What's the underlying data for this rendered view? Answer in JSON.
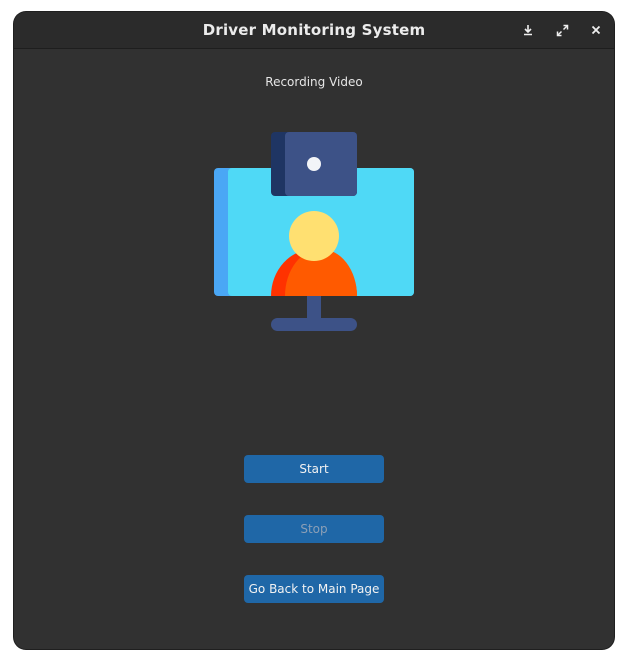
{
  "window": {
    "title": "Driver Monitoring System",
    "controls": [
      "download-icon",
      "expand-icon",
      "close-icon"
    ]
  },
  "main": {
    "heading": "Recording Video",
    "illustration": "webcam-monitor-person",
    "buttons": {
      "start_label": "Start",
      "stop_label": "Stop",
      "back_label": "Go Back to Main Page"
    }
  },
  "colors": {
    "window_bg": "#313131",
    "titlebar_bg": "#2b2b2b",
    "button_bg": "#1f67a7",
    "monitor_screen": "#4fd9f6",
    "monitor_edge": "#4aa7f5",
    "camera_body": "#3d5287",
    "person_head": "#ffe071",
    "person_body": "#ff5a00"
  }
}
